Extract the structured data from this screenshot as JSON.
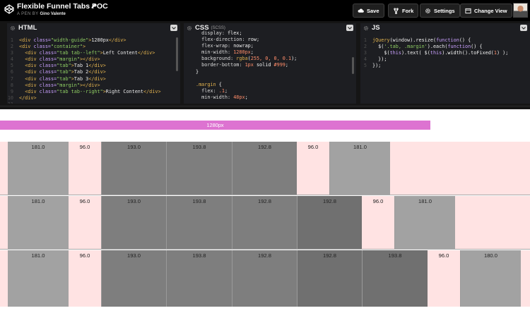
{
  "header": {
    "title": "Flexible Funnel Tabs POC",
    "byline_prefix": "A PEN BY",
    "author": "Gino Valente",
    "buttons": {
      "save": "Save",
      "fork": "Fork",
      "settings": "Settings",
      "change_view": "Change View"
    }
  },
  "editors": {
    "html": {
      "title": "HTML",
      "lines": [
        {
          "num": "1",
          "parts": [
            [
              "t-tag",
              "<div "
            ],
            [
              "t-attr",
              "class="
            ],
            [
              "t-str",
              "\"width-guide\""
            ],
            [
              "t-tag",
              ">"
            ],
            [
              "t-txt",
              "1280px"
            ],
            [
              "t-tag",
              "</div>"
            ]
          ]
        },
        {
          "num": "2",
          "parts": [
            [
              "t-tag",
              "<div "
            ],
            [
              "t-attr",
              "class="
            ],
            [
              "t-str",
              "\"container\""
            ],
            [
              "t-tag",
              ">"
            ]
          ]
        },
        {
          "num": "3",
          "parts": [
            [
              "t-txt",
              "  "
            ],
            [
              "t-tag",
              "<div "
            ],
            [
              "t-attr",
              "class="
            ],
            [
              "t-str",
              "\"tab tab--left\""
            ],
            [
              "t-tag",
              ">"
            ],
            [
              "t-txt",
              "Left Content"
            ],
            [
              "t-tag",
              "</div>"
            ]
          ]
        },
        {
          "num": "4",
          "parts": [
            [
              "t-txt",
              "  "
            ],
            [
              "t-tag",
              "<div "
            ],
            [
              "t-attr",
              "class="
            ],
            [
              "t-str",
              "\"margin\""
            ],
            [
              "t-tag",
              "></div>"
            ]
          ]
        },
        {
          "num": "5",
          "parts": [
            [
              "t-txt",
              "  "
            ],
            [
              "t-tag",
              "<div "
            ],
            [
              "t-attr",
              "class="
            ],
            [
              "t-str",
              "\"tab\""
            ],
            [
              "t-tag",
              ">"
            ],
            [
              "t-txt",
              "Tab 1"
            ],
            [
              "t-tag",
              "</div>"
            ]
          ]
        },
        {
          "num": "6",
          "parts": [
            [
              "t-txt",
              "  "
            ],
            [
              "t-tag",
              "<div "
            ],
            [
              "t-attr",
              "class="
            ],
            [
              "t-str",
              "\"tab\""
            ],
            [
              "t-tag",
              ">"
            ],
            [
              "t-txt",
              "Tab 2"
            ],
            [
              "t-tag",
              "</div>"
            ]
          ]
        },
        {
          "num": "7",
          "parts": [
            [
              "t-txt",
              "  "
            ],
            [
              "t-tag",
              "<div "
            ],
            [
              "t-attr",
              "class="
            ],
            [
              "t-str",
              "\"tab\""
            ],
            [
              "t-tag",
              ">"
            ],
            [
              "t-txt",
              "Tab 3"
            ],
            [
              "t-tag",
              "</div>"
            ]
          ]
        },
        {
          "num": "8",
          "parts": [
            [
              "t-txt",
              "  "
            ],
            [
              "t-tag",
              "<div "
            ],
            [
              "t-attr",
              "class="
            ],
            [
              "t-str",
              "\"margin\""
            ],
            [
              "t-tag",
              "></div>"
            ]
          ]
        },
        {
          "num": "9",
          "parts": [
            [
              "t-txt",
              "  "
            ],
            [
              "t-tag",
              "<div "
            ],
            [
              "t-attr",
              "class="
            ],
            [
              "t-str",
              "\"tab tab--right\""
            ],
            [
              "t-tag",
              ">"
            ],
            [
              "t-txt",
              "Right Content"
            ],
            [
              "t-tag",
              "</div>"
            ]
          ]
        },
        {
          "num": "10",
          "parts": [
            [
              "t-tag",
              "</div>"
            ]
          ]
        },
        {
          "num": "11",
          "parts": []
        }
      ]
    },
    "css": {
      "title": "CSS",
      "subtitle": "(SCSS)",
      "lines": [
        {
          "num": "",
          "parts": [
            [
              "t-prop",
              "  display: "
            ],
            [
              "t-val",
              "flex;"
            ]
          ]
        },
        {
          "num": "",
          "parts": [
            [
              "t-prop",
              "  flex-direction: "
            ],
            [
              "t-val",
              "row;"
            ]
          ]
        },
        {
          "num": "",
          "parts": [
            [
              "t-prop",
              "  flex-wrap: "
            ],
            [
              "t-val",
              "nowrap;"
            ]
          ]
        },
        {
          "num": "",
          "parts": [
            [
              "t-prop",
              "  min-width: "
            ],
            [
              "t-num",
              "1280px"
            ],
            [
              "t-val",
              ";"
            ]
          ]
        },
        {
          "num": "",
          "parts": [
            [
              "t-prop",
              "  background: "
            ],
            [
              "t-fn",
              "rgba"
            ],
            [
              "t-val",
              "("
            ],
            [
              "t-num",
              "255, 0, 0, 0.1"
            ],
            [
              "t-val",
              ");"
            ]
          ]
        },
        {
          "num": "",
          "parts": [
            [
              "t-prop",
              "  border-bottom: "
            ],
            [
              "t-num",
              "1px"
            ],
            [
              "t-val",
              " solid "
            ],
            [
              "t-num",
              "#999"
            ],
            [
              "t-val",
              ";"
            ]
          ]
        },
        {
          "num": "",
          "parts": [
            [
              "t-val",
              "}"
            ]
          ]
        },
        {
          "num": "",
          "parts": []
        },
        {
          "num": "",
          "parts": [
            [
              "t-sel",
              ".margin"
            ],
            [
              "t-val",
              " {"
            ]
          ]
        },
        {
          "num": "",
          "parts": [
            [
              "t-prop",
              "  flex: "
            ],
            [
              "t-num",
              ".1"
            ],
            [
              "t-val",
              ";"
            ]
          ]
        },
        {
          "num": "",
          "parts": [
            [
              "t-prop",
              "  min-width: "
            ],
            [
              "t-num",
              "48px"
            ],
            [
              "t-val",
              ";"
            ]
          ]
        }
      ]
    },
    "js": {
      "title": "JS",
      "lines": [
        {
          "num": "1",
          "parts": [
            [
              "t-fn",
              "jQuery"
            ],
            [
              "t-val",
              "("
            ],
            [
              "t-txt",
              "window"
            ],
            [
              "t-val",
              ").resize("
            ],
            [
              "t-kw",
              "function"
            ],
            [
              "t-val",
              "() {"
            ]
          ]
        },
        {
          "num": "2",
          "parts": [
            [
              "t-val",
              "  $("
            ],
            [
              "t-str",
              "'.tab, .margin'"
            ],
            [
              "t-val",
              ").each("
            ],
            [
              "t-kw",
              "function"
            ],
            [
              "t-val",
              "() {"
            ]
          ]
        },
        {
          "num": "3",
          "parts": [
            [
              "t-val",
              "    $("
            ],
            [
              "t-kw",
              "this"
            ],
            [
              "t-val",
              ").text( $("
            ],
            [
              "t-kw",
              "this"
            ],
            [
              "t-val",
              ").width().toFixed("
            ],
            [
              "t-num",
              "1"
            ],
            [
              "t-val",
              ") );"
            ]
          ]
        },
        {
          "num": "4",
          "parts": [
            [
              "t-val",
              "  });"
            ]
          ]
        },
        {
          "num": "5",
          "parts": [
            [
              "t-val",
              "});"
            ]
          ]
        }
      ]
    }
  },
  "preview": {
    "width_guide": "1280px",
    "rows": [
      {
        "cells": [
          {
            "label": "181.0",
            "kind": "tab1"
          },
          {
            "label": "96.0",
            "kind": "margin"
          },
          {
            "label": "193.0",
            "kind": "tab2"
          },
          {
            "label": "193.8",
            "kind": "tab2"
          },
          {
            "label": "192.8",
            "kind": "tab2"
          },
          {
            "label": "96.0",
            "kind": "margin"
          },
          {
            "label": "181.0",
            "kind": "tab1"
          }
        ]
      },
      {
        "cells": [
          {
            "label": "181.0",
            "kind": "tab1"
          },
          {
            "label": "96.0",
            "kind": "margin"
          },
          {
            "label": "193.0",
            "kind": "tab2"
          },
          {
            "label": "193.8",
            "kind": "tab2"
          },
          {
            "label": "192.8",
            "kind": "tab2"
          },
          {
            "label": "192.8",
            "kind": "tab3"
          },
          {
            "label": "96.0",
            "kind": "margin"
          },
          {
            "label": "181.0",
            "kind": "tab1"
          }
        ]
      },
      {
        "cells": [
          {
            "label": "181.0",
            "kind": "tab1"
          },
          {
            "label": "96.0",
            "kind": "margin"
          },
          {
            "label": "193.0",
            "kind": "tab2"
          },
          {
            "label": "193.8",
            "kind": "tab2"
          },
          {
            "label": "192.8",
            "kind": "tab2"
          },
          {
            "label": "192.8",
            "kind": "tab3"
          },
          {
            "label": "193.8",
            "kind": "tab3"
          },
          {
            "label": "96.0",
            "kind": "margin"
          },
          {
            "label": "180.0",
            "kind": "tab1"
          }
        ]
      }
    ]
  }
}
